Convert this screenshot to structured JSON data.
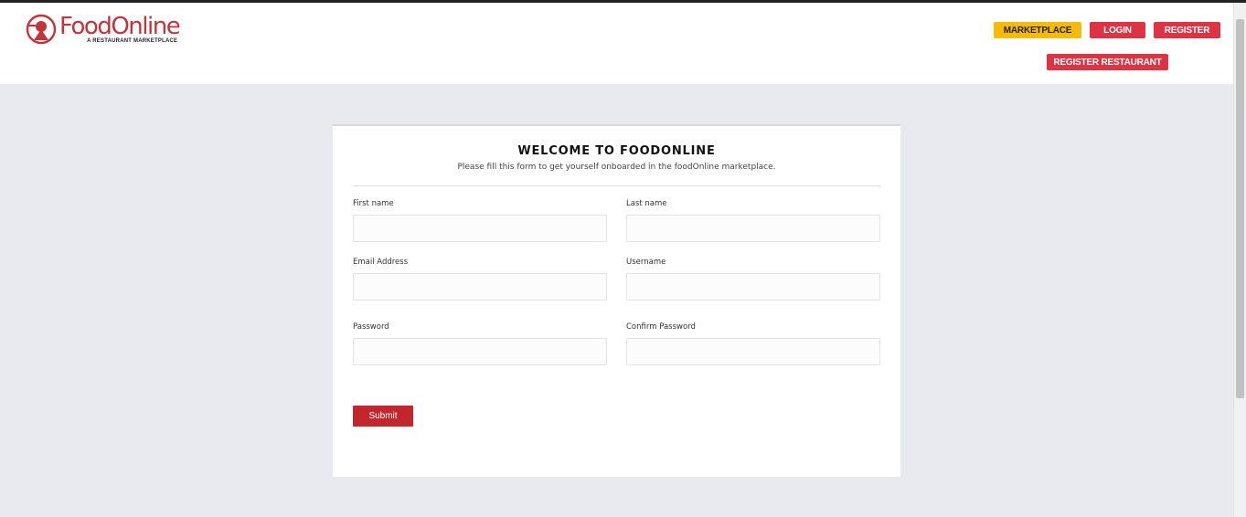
{
  "brand": {
    "name": "FoodOnline",
    "tagline": "A RESTAURANT MARKETPLACE",
    "color": "#c3343a"
  },
  "nav": {
    "marketplace": "MARKETPLACE",
    "login": "LOGIN",
    "register": "REGISTER",
    "register_restaurant": "REGISTER RESTAURANT"
  },
  "colors": {
    "accent_red": "#dd3343",
    "accent_yellow": "#f6bb09",
    "submit_red": "#c1272d",
    "page_bg": "#e9eaef"
  },
  "form": {
    "title": "WELCOME TO FOODONLINE",
    "subtitle": "Please fill this form to get yourself onboarded in the foodOnline marketplace.",
    "fields": {
      "first_name": {
        "label": "First name",
        "value": ""
      },
      "last_name": {
        "label": "Last name",
        "value": ""
      },
      "email": {
        "label": "Email Address",
        "value": ""
      },
      "username": {
        "label": "Username",
        "value": ""
      },
      "password": {
        "label": "Password",
        "value": ""
      },
      "confirm_password": {
        "label": "Confirm Password",
        "value": ""
      }
    },
    "submit_label": "Submit"
  }
}
